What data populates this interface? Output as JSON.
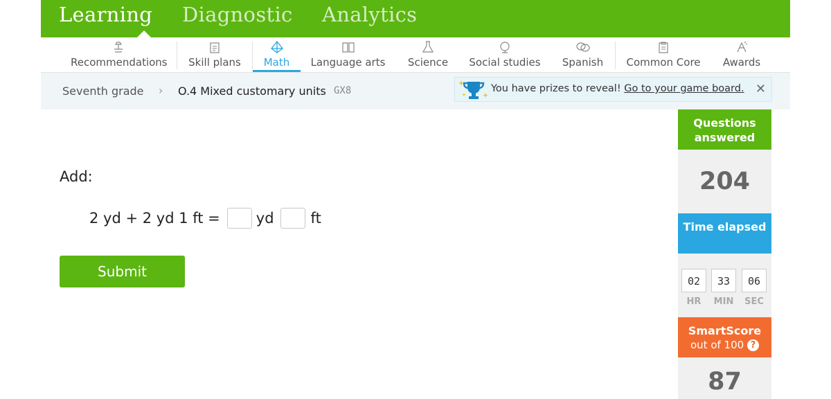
{
  "topnav": {
    "tabs": [
      {
        "label": "Learning",
        "active": true
      },
      {
        "label": "Diagnostic",
        "active": false
      },
      {
        "label": "Analytics",
        "active": false
      }
    ],
    "bg_color": "#5cb612"
  },
  "subjects": [
    {
      "label": "Recommendations",
      "icon": "recommendations-icon"
    },
    {
      "label": "Skill plans",
      "icon": "skill-plans-icon"
    },
    {
      "label": "Math",
      "icon": "math-icon",
      "active": true
    },
    {
      "label": "Language arts",
      "icon": "language-arts-icon"
    },
    {
      "label": "Science",
      "icon": "science-icon"
    },
    {
      "label": "Social studies",
      "icon": "social-studies-icon"
    },
    {
      "label": "Spanish",
      "icon": "spanish-icon"
    },
    {
      "label": "Common Core",
      "icon": "common-core-icon"
    },
    {
      "label": "Awards",
      "icon": "awards-icon"
    }
  ],
  "breadcrumb": {
    "grade": "Seventh grade",
    "separator": "›",
    "skill": "O.4 Mixed customary units",
    "code": "GX8"
  },
  "prize_banner": {
    "text": "You have prizes to reveal!",
    "link": "Go to your game board.",
    "close": "✕"
  },
  "question": {
    "prompt": "Add:",
    "expression": "2 yd + 2 yd 1 ft =",
    "unit1": "yd",
    "unit2": "ft",
    "answer1": "",
    "answer2": ""
  },
  "submit_label": "Submit",
  "sidebar": {
    "questions_answered_label": "Questions answered",
    "questions_answered": "204",
    "time_elapsed_label": "Time elapsed",
    "time": {
      "hr": "02",
      "min": "33",
      "sec": "06"
    },
    "time_units": {
      "hr": "HR",
      "min": "MIN",
      "sec": "SEC"
    },
    "smartscore_label": "SmartScore",
    "smartscore_sub": "out of 100",
    "smartscore_help": "?",
    "smartscore_value": "87"
  },
  "colors": {
    "green": "#5cb612",
    "blue": "#2aa7e0",
    "orange": "#f26c30"
  }
}
